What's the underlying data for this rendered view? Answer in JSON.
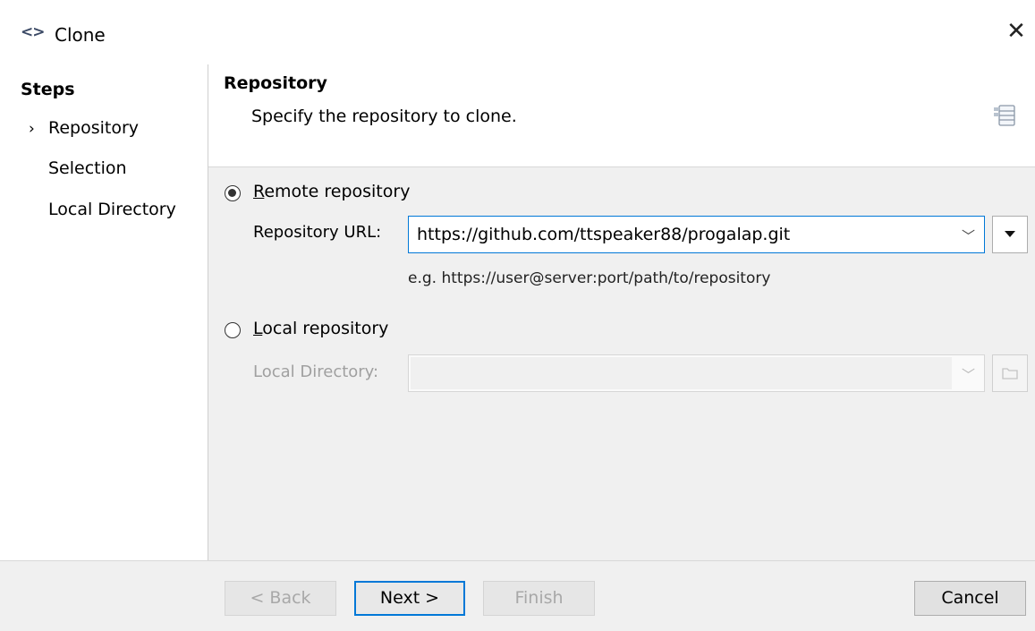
{
  "window": {
    "title": "Clone",
    "app_icon": "<>",
    "close_glyph": "✕"
  },
  "steps": {
    "title": "Steps",
    "current_marker": "›",
    "items": [
      "Repository",
      "Selection",
      "Local Directory"
    ]
  },
  "header": {
    "title": "Repository",
    "description": "Specify the repository to clone."
  },
  "remote": {
    "radio_label_underlined": "R",
    "radio_label_rest": "emote repository",
    "checked": true,
    "url_label": "Repository URL:",
    "url_value": "https://github.com/ttspeaker88/progalap.git",
    "hint": "e.g. https://user@server:port/path/to/repository"
  },
  "local": {
    "radio_label_underlined": "L",
    "radio_label_rest": "ocal repository",
    "checked": false,
    "dir_label": "Local Directory:",
    "dir_value": ""
  },
  "footer": {
    "back_label": "< Back",
    "next_label": "Next >",
    "finish_label": "Finish",
    "cancel_label": "Cancel"
  },
  "icons": {
    "app": "diamond-brackets-icon",
    "close": "close-icon",
    "header": "wizard-banner-icon",
    "url_menu": "dropdown-triangle-icon",
    "browse": "folder-icon"
  },
  "colors": {
    "accent": "#0078d7",
    "disabled_text": "#a8a8a8"
  }
}
